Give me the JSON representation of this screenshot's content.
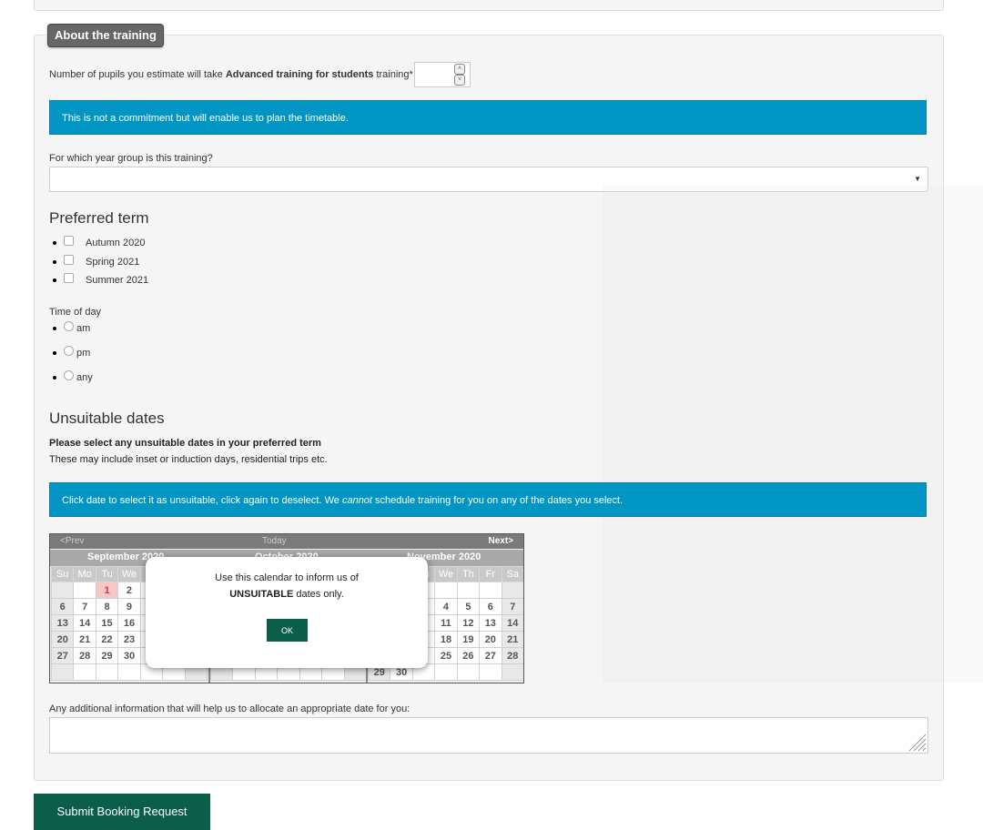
{
  "section": {
    "legend": "About the training",
    "pupils_prefix": "Number of pupils you estimate will take ",
    "pupils_bold": "Advanced training for students",
    "pupils_suffix": " training*",
    "pupils_value": "",
    "commitment_note": "This is not a commitment but will enable us to plan the timetable.",
    "year_group_label": "For which year group is this training?",
    "year_group_value": ""
  },
  "preferred_term": {
    "heading": "Preferred term",
    "options": [
      "Autumn 2020",
      "Spring 2021",
      "Summer 2021"
    ]
  },
  "time_of_day": {
    "label": "Time of day",
    "options": [
      "am",
      "pm",
      "any"
    ]
  },
  "unsuitable": {
    "heading": "Unsuitable dates",
    "instruction_bold": "Please select any unsuitable dates in your preferred term",
    "instruction": "These may include inset or induction days, residential trips etc.",
    "note_prefix": "Click date to select it as unsuitable, click again to deselect. We ",
    "note_em": "cannot",
    "note_suffix": " schedule training for you on any of the dates you select."
  },
  "calendar": {
    "prev": "<Prev",
    "today": "Today",
    "next": "Next>",
    "months": [
      "September 2020",
      "October 2020",
      "November 2020"
    ],
    "dow": [
      "Su",
      "Mo",
      "Tu",
      "We",
      "Th",
      "Fr",
      "Sa"
    ],
    "sept_weeks": [
      [
        "",
        "",
        "1",
        "2",
        "",
        "",
        ""
      ],
      [
        "6",
        "7",
        "8",
        "9",
        "",
        "",
        ""
      ],
      [
        "13",
        "14",
        "15",
        "16",
        "",
        "",
        ""
      ],
      [
        "20",
        "21",
        "22",
        "23",
        "",
        "",
        ""
      ],
      [
        "27",
        "28",
        "29",
        "30",
        "",
        "",
        ""
      ],
      [
        "",
        "",
        "",
        "",
        "",
        "",
        ""
      ]
    ],
    "oct_last_row": [
      "",
      "",
      "",
      "",
      "",
      "",
      ""
    ],
    "nov_weeks": [
      [
        "",
        "",
        "",
        "",
        "",
        "",
        ""
      ],
      [
        "",
        "",
        "",
        "4",
        "5",
        "6",
        "7"
      ],
      [
        "",
        "",
        "",
        "11",
        "12",
        "13",
        "14"
      ],
      [
        "",
        "",
        "",
        "18",
        "19",
        "20",
        "21"
      ],
      [
        "",
        "",
        "",
        "25",
        "26",
        "27",
        "28"
      ],
      [
        "29",
        "30",
        "",
        "",
        "",
        "",
        ""
      ]
    ],
    "selected": "1"
  },
  "modal": {
    "line1": "Use this calendar to inform us of",
    "line2_bold": "UNSUITABLE",
    "line2_rest": " dates only.",
    "ok_label": "OK"
  },
  "additional": {
    "label": "Any additional information that will help us to allocate an appropriate date for you:",
    "value": ""
  },
  "submit_label": "Submit Booking Request",
  "colors": {
    "info_bar": "#0095c3",
    "primary_button": "#0b5e4a",
    "legend_bg": "#666666"
  }
}
